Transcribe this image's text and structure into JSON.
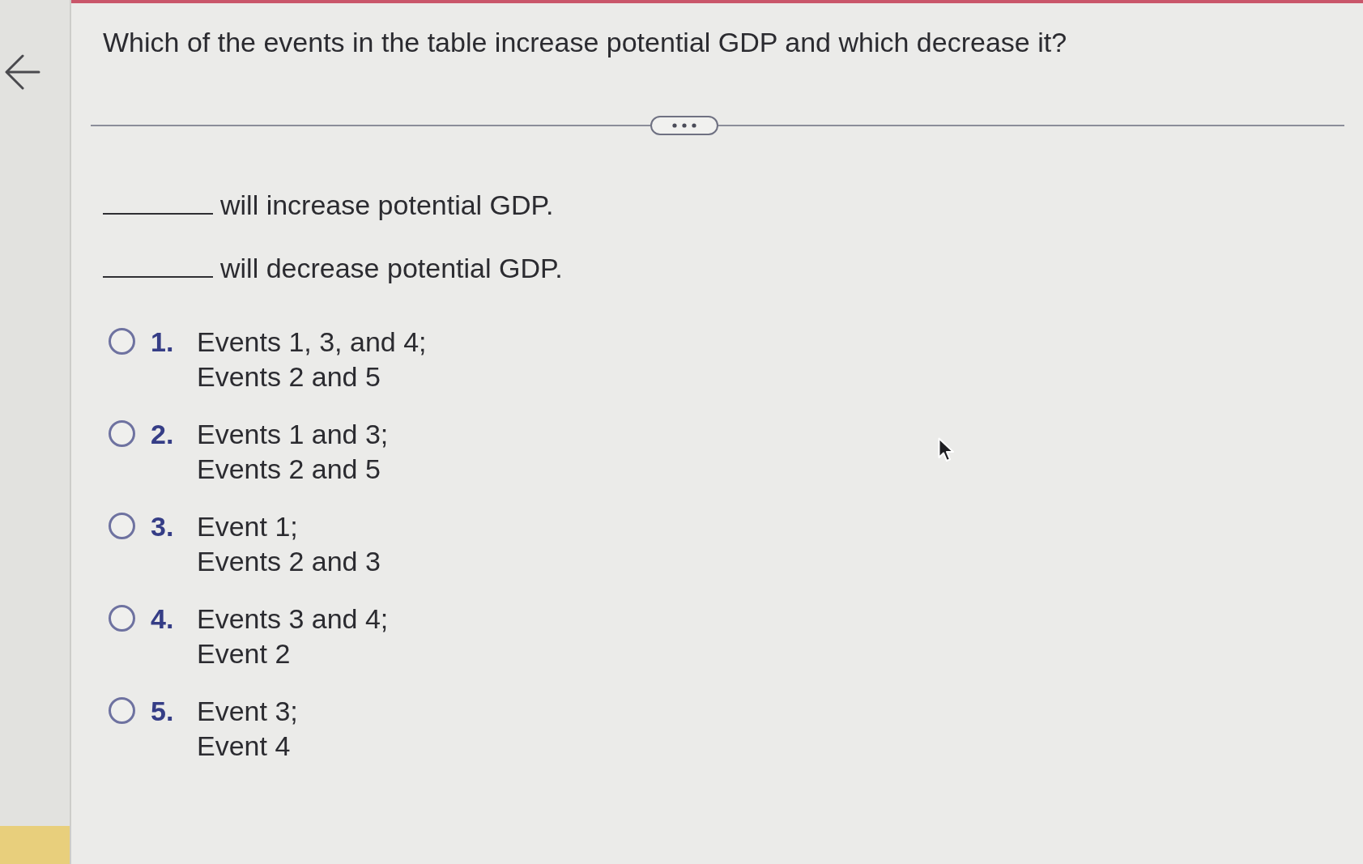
{
  "question": {
    "text": "Which of the events in the table increase potential GDP and which decrease it?"
  },
  "statements": [
    {
      "text": "will increase potential GDP."
    },
    {
      "text": "will decrease potential GDP."
    }
  ],
  "options": [
    {
      "number": "1.",
      "lines": [
        "Events 1, 3, and 4;",
        "Events 2 and 5"
      ],
      "selected": false
    },
    {
      "number": "2.",
      "lines": [
        "Events 1 and 3;",
        "Events 2 and 5"
      ],
      "selected": false
    },
    {
      "number": "3.",
      "lines": [
        "Event 1;",
        "Events 2 and 3"
      ],
      "selected": false
    },
    {
      "number": "4.",
      "lines": [
        "Events 3 and 4;",
        "Event 2"
      ],
      "selected": false
    },
    {
      "number": "5.",
      "lines": [
        "Event 3;",
        "Event 4"
      ],
      "selected": false
    }
  ]
}
